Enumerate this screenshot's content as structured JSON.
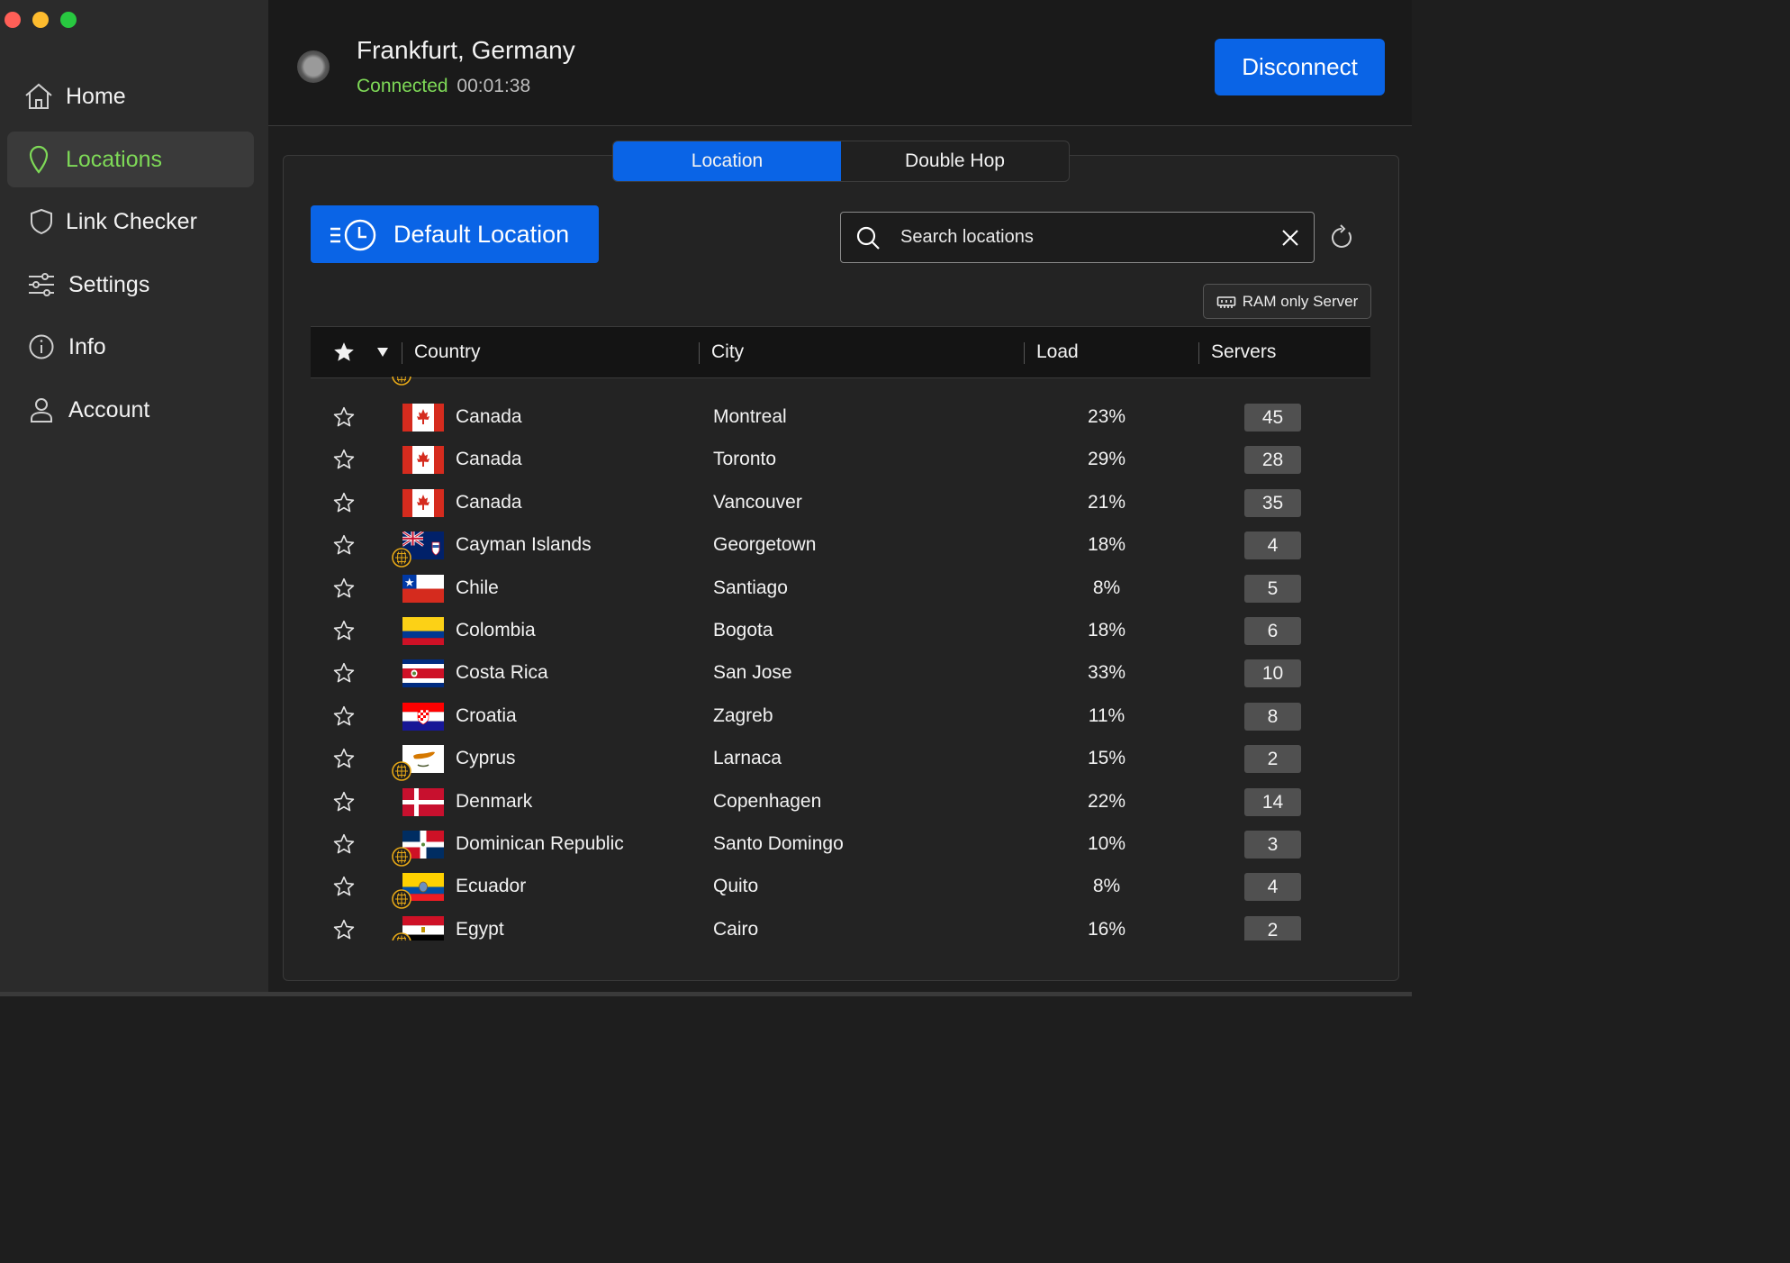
{
  "sidebar": {
    "items": [
      {
        "label": "Home",
        "icon": "home-icon"
      },
      {
        "label": "Locations",
        "icon": "map-pin-icon",
        "active": true
      },
      {
        "label": "Link Checker",
        "icon": "shield-icon"
      },
      {
        "label": "Settings",
        "icon": "sliders-icon"
      },
      {
        "label": "Info",
        "icon": "info-icon"
      },
      {
        "label": "Account",
        "icon": "user-icon"
      }
    ]
  },
  "header": {
    "location": "Frankfurt, Germany",
    "status": "Connected",
    "elapsed": "00:01:38",
    "disconnect_label": "Disconnect"
  },
  "tabs": [
    {
      "label": "Location",
      "active": true
    },
    {
      "label": "Double Hop",
      "active": false
    }
  ],
  "default_location_label": "Default Location",
  "search": {
    "placeholder": "Search locations",
    "value": ""
  },
  "ram_only_label": "RAM only Server",
  "table": {
    "columns": {
      "country": "Country",
      "city": "City",
      "load": "Load",
      "servers": "Servers"
    },
    "rows": [
      {
        "country": "Canada",
        "city": "Montreal",
        "load": "23%",
        "servers": "45",
        "flag": "ca",
        "tor": false
      },
      {
        "country": "Canada",
        "city": "Toronto",
        "load": "29%",
        "servers": "28",
        "flag": "ca",
        "tor": false
      },
      {
        "country": "Canada",
        "city": "Vancouver",
        "load": "21%",
        "servers": "35",
        "flag": "ca",
        "tor": false
      },
      {
        "country": "Cayman Islands",
        "city": "Georgetown",
        "load": "18%",
        "servers": "4",
        "flag": "ky",
        "tor": true
      },
      {
        "country": "Chile",
        "city": "Santiago",
        "load": "8%",
        "servers": "5",
        "flag": "cl",
        "tor": false
      },
      {
        "country": "Colombia",
        "city": "Bogota",
        "load": "18%",
        "servers": "6",
        "flag": "co",
        "tor": false
      },
      {
        "country": "Costa Rica",
        "city": "San Jose",
        "load": "33%",
        "servers": "10",
        "flag": "cr",
        "tor": false
      },
      {
        "country": "Croatia",
        "city": "Zagreb",
        "load": "11%",
        "servers": "8",
        "flag": "hr",
        "tor": false
      },
      {
        "country": "Cyprus",
        "city": "Larnaca",
        "load": "15%",
        "servers": "2",
        "flag": "cy",
        "tor": true
      },
      {
        "country": "Denmark",
        "city": "Copenhagen",
        "load": "22%",
        "servers": "14",
        "flag": "dk",
        "tor": false
      },
      {
        "country": "Dominican Republic",
        "city": "Santo Domingo",
        "load": "10%",
        "servers": "3",
        "flag": "do",
        "tor": true
      },
      {
        "country": "Ecuador",
        "city": "Quito",
        "load": "8%",
        "servers": "4",
        "flag": "ec",
        "tor": true
      },
      {
        "country": "Egypt",
        "city": "Cairo",
        "load": "16%",
        "servers": "2",
        "flag": "eg",
        "tor": true
      }
    ]
  },
  "colors": {
    "accent": "#0a64e6",
    "connected": "#7ed957",
    "tor_badge": "#e6a817"
  }
}
